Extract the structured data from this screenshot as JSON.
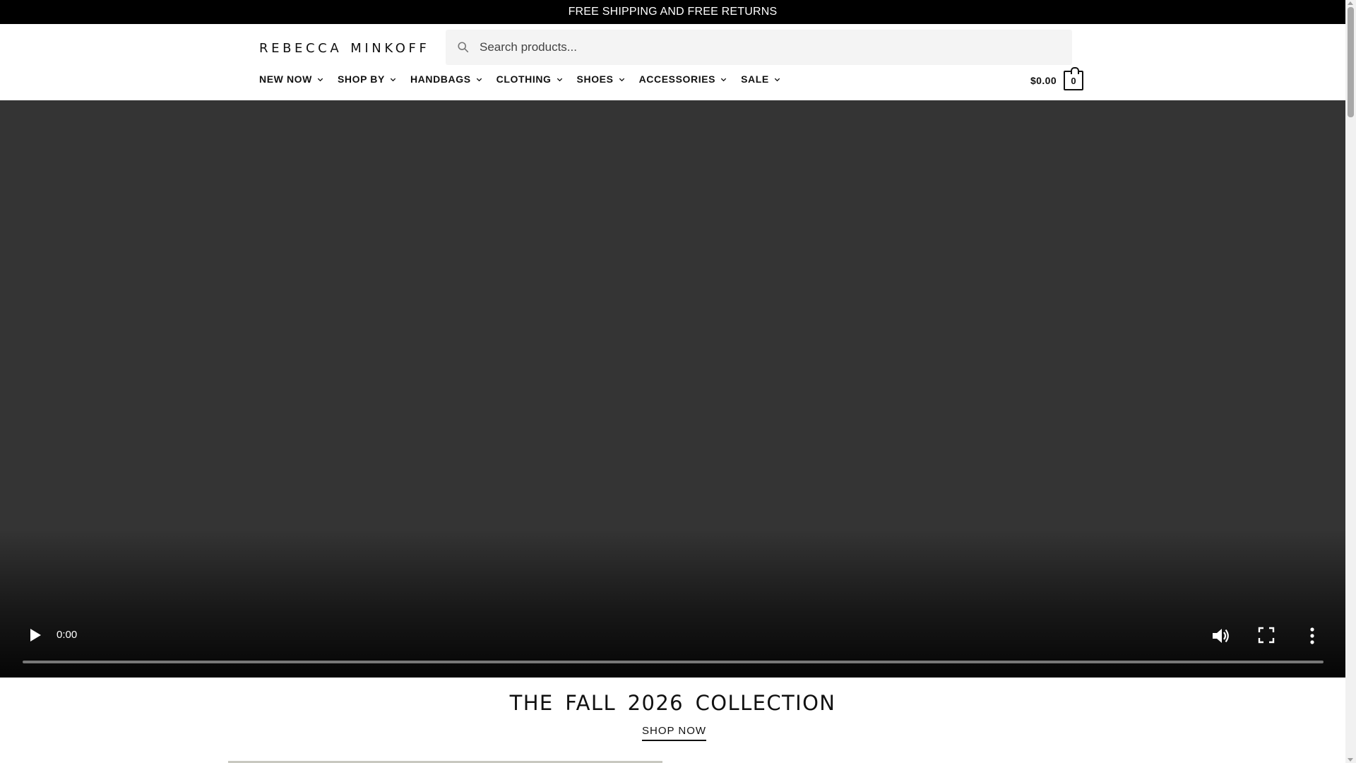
{
  "announcement": {
    "text": "FREE SHIPPING AND FREE RETURNS"
  },
  "header": {
    "logo_word1": "REBECCA",
    "logo_word2": "MINKOFF",
    "search": {
      "placeholder": "Search products...",
      "icon": "search-icon"
    },
    "nav": [
      {
        "label": "NEW NOW"
      },
      {
        "label": "SHOP BY"
      },
      {
        "label": "HANDBAGS"
      },
      {
        "label": "CLOTHING"
      },
      {
        "label": "SHOES"
      },
      {
        "label": "ACCESSORIES"
      },
      {
        "label": "SALE"
      }
    ],
    "cart": {
      "total": "$0.00",
      "count": "0",
      "icon": "shopping-bag-icon"
    }
  },
  "video": {
    "time": "0:00",
    "progress": 0,
    "icons": [
      "play-icon",
      "volume-icon",
      "fullscreen-icon",
      "more-options-icon"
    ]
  },
  "collection": {
    "title": "THE FALL 2026 COLLECTION",
    "cta": "SHOP NOW"
  },
  "colors": {
    "announcement_bg": "#000000",
    "video_bg": "#343434",
    "search_bg": "#f4f4f4",
    "text": "#111111"
  }
}
